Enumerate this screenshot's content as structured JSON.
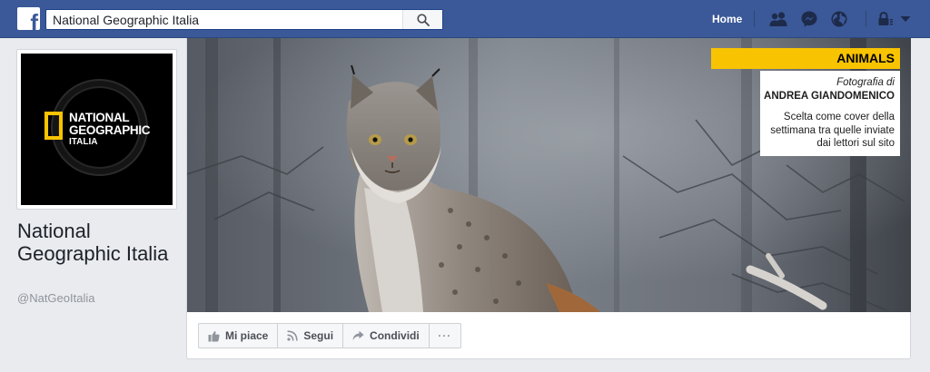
{
  "search": {
    "value": "National Geographic Italia",
    "placeholder": ""
  },
  "nav": {
    "home_label": "Home",
    "icons": [
      "friends-icon",
      "messenger-icon",
      "globe-icon",
      "lock-icon",
      "chevron-down-icon"
    ]
  },
  "profile": {
    "logo_line1": "NATIONAL",
    "logo_line2": "GEOGRAPHIC",
    "logo_line3": "ITALIA",
    "name": "National Geographic Italia",
    "handle": "@NatGeoItalia"
  },
  "cover": {
    "category": "ANIMALS",
    "photo_by": "Fotografia di",
    "author": "ANDREA GIANDOMENICO",
    "description": "Scelta come cover della settimana tra quelle inviate dai lettori sul sito"
  },
  "actions": {
    "like_label": "Mi piace",
    "follow_label": "Segui",
    "share_label": "Condividi",
    "more_label": "···"
  },
  "colors": {
    "facebook_blue": "#3b5998",
    "natgeo_yellow": "#f8c300",
    "page_background": "#e9ebee"
  }
}
